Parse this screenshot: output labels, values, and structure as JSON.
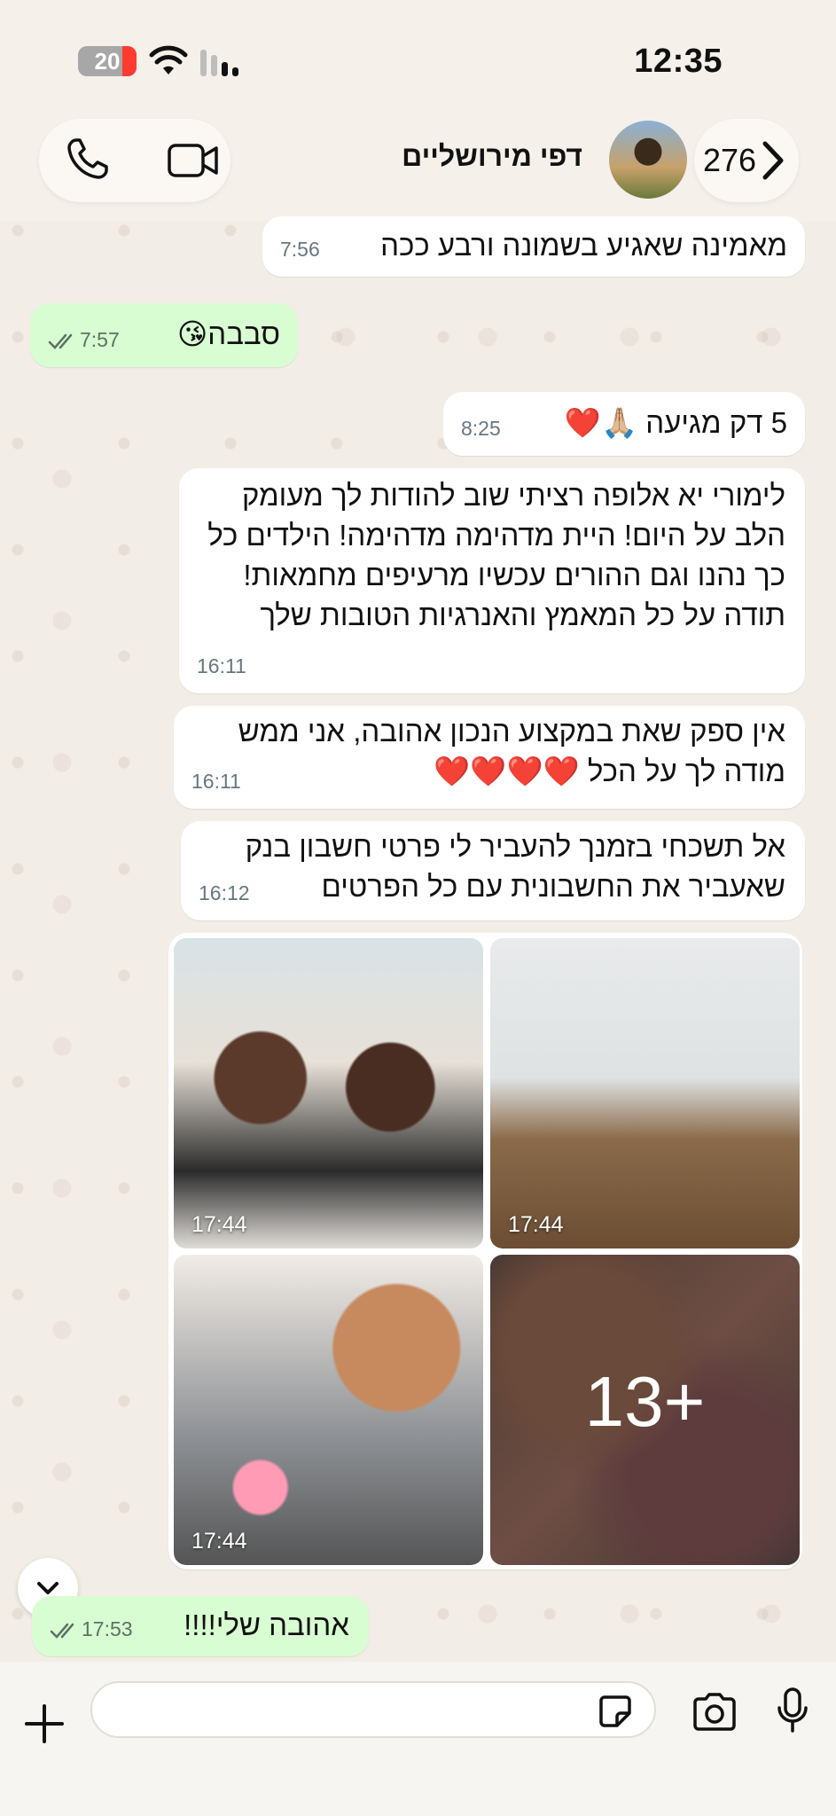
{
  "status_bar": {
    "time": "12:35",
    "battery": "20"
  },
  "header": {
    "contact_name": "דפי מירושליים",
    "unread_count": "276"
  },
  "messages": [
    {
      "dir": "in",
      "text": "מאמינה שאגיע בשמונה ורבע ככה",
      "time": "7:56"
    },
    {
      "dir": "out",
      "text": "סבבה😘",
      "time": "7:57"
    },
    {
      "dir": "in",
      "text": "5 דק מגיעה 🙏🏼❤️",
      "time": "8:25"
    },
    {
      "dir": "in",
      "text": "לימורי יא אלופה רציתי שוב להודות לך מעומק הלב על היום! היית מדהימה מדהימה! הילדים כל כך נהנו וגם ההורים עכשיו מרעיפים מחמאות! תודה על כל המאמץ והאנרגיות הטובות שלך",
      "time": "16:11"
    },
    {
      "dir": "in",
      "text": "אין ספק שאת במקצוע הנכון אהובה, אני ממש מודה לך על הכל ❤️❤️❤️❤️",
      "time": "16:11"
    },
    {
      "dir": "in",
      "text": "אל תשכחי בזמנך להעביר לי פרטי חשבון בנק שאעביר את החשבונית עם כל הפרטים",
      "time": "16:12"
    },
    {
      "dir": "out",
      "text": "אהובה שלי!!!!",
      "time": "17:53"
    }
  ],
  "album": {
    "tiles": [
      {
        "time": "17:44"
      },
      {
        "time": "17:44"
      },
      {
        "time": "17:44"
      },
      {
        "more": "13+"
      }
    ]
  },
  "input": {
    "placeholder": ""
  }
}
